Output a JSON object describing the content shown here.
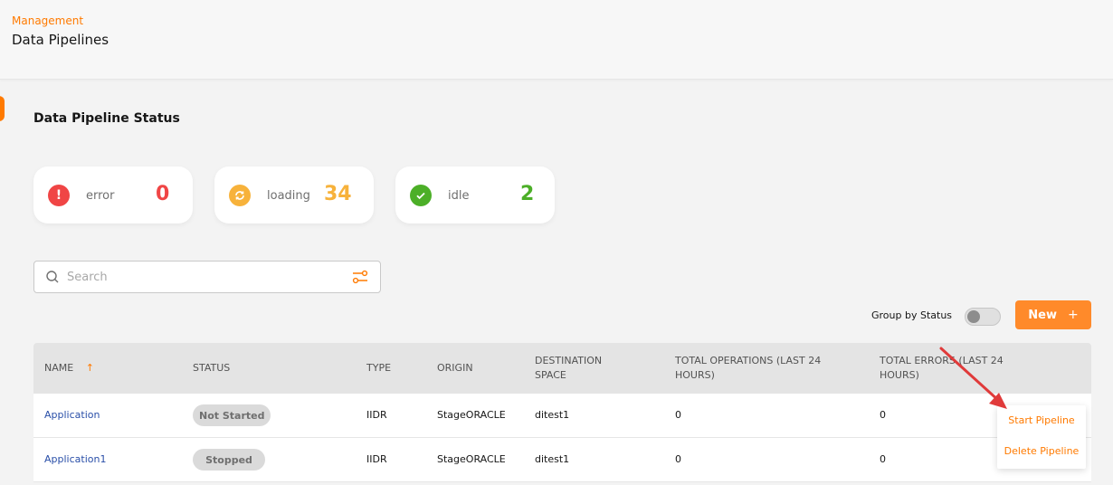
{
  "header": {
    "breadcrumb": "Management",
    "title": "Data Pipelines"
  },
  "section_title": "Data Pipeline Status",
  "stats": [
    {
      "label": "error",
      "value": "0",
      "color": "#f04545",
      "icon": "error-icon"
    },
    {
      "label": "loading",
      "value": "34",
      "color": "#f7b23b",
      "icon": "loading-icon"
    },
    {
      "label": "idle",
      "value": "2",
      "color": "#4caf28",
      "icon": "check-icon"
    }
  ],
  "search": {
    "placeholder": "Search",
    "value": ""
  },
  "group_by_status": {
    "label": "Group by Status",
    "enabled": false
  },
  "new_button": {
    "label": "New",
    "icon_glyph": "+"
  },
  "table": {
    "columns": [
      "NAME",
      "STATUS",
      "TYPE",
      "ORIGIN",
      "DESTINATION SPACE",
      "TOTAL OPERATIONS (LAST 24 HOURS)",
      "TOTAL ERRORS (LAST 24 HOURS)"
    ],
    "sort_glyph": "↑",
    "rows": [
      {
        "name": "Application",
        "status": "Not Started",
        "type": "IIDR",
        "origin": "StageORACLE",
        "destination": "ditest1",
        "total_operations": "0",
        "total_errors": "0"
      },
      {
        "name": "Application1",
        "status": "Stopped",
        "type": "IIDR",
        "origin": "StageORACLE",
        "destination": "ditest1",
        "total_operations": "0",
        "total_errors": "0"
      }
    ]
  },
  "context_menu": {
    "items": [
      "Start Pipeline",
      "Delete Pipeline"
    ]
  },
  "colors": {
    "accent": "#ff7a00",
    "link": "#2a4fa8",
    "annotation_arrow": "#e03a3a"
  }
}
